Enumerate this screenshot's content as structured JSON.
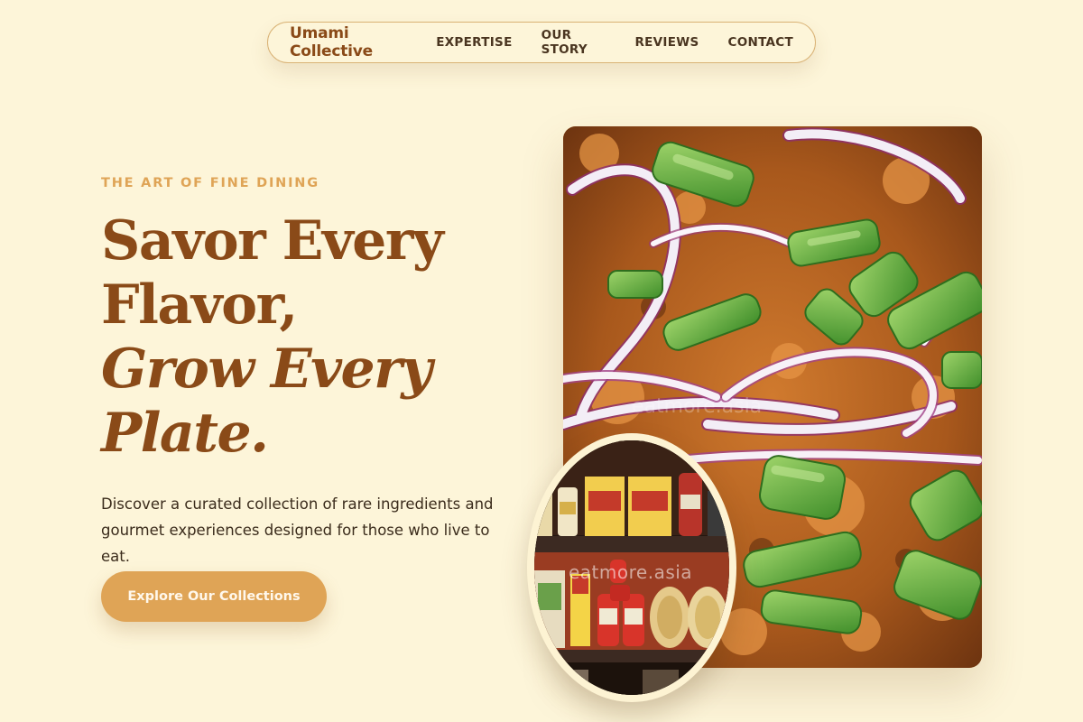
{
  "nav": {
    "brand": "Umami Collective",
    "links": [
      "EXPERTISE",
      "OUR STORY",
      "REVIEWS",
      "CONTACT"
    ]
  },
  "hero": {
    "eyebrow": "THE ART OF FINE DINING",
    "headline_lines": [
      "Savor Every",
      "Flavor,",
      "Grow Every",
      "Plate."
    ],
    "description": "Discover a curated collection of rare ingredients and gourmet experiences designed for those who live to eat.",
    "cta_label": "Explore Our Collections"
  },
  "images": {
    "main_alt": "Close-up of dish topped with sliced red onion and green onion",
    "secondary_alt": "Shelves stocked with jars, boxes and pasta packages",
    "watermark": "eatmore.asia"
  },
  "colors": {
    "background": "#fdf5d9",
    "accent": "#dfa456",
    "brand": "#8a4a18",
    "text": "#3b2c1c"
  }
}
